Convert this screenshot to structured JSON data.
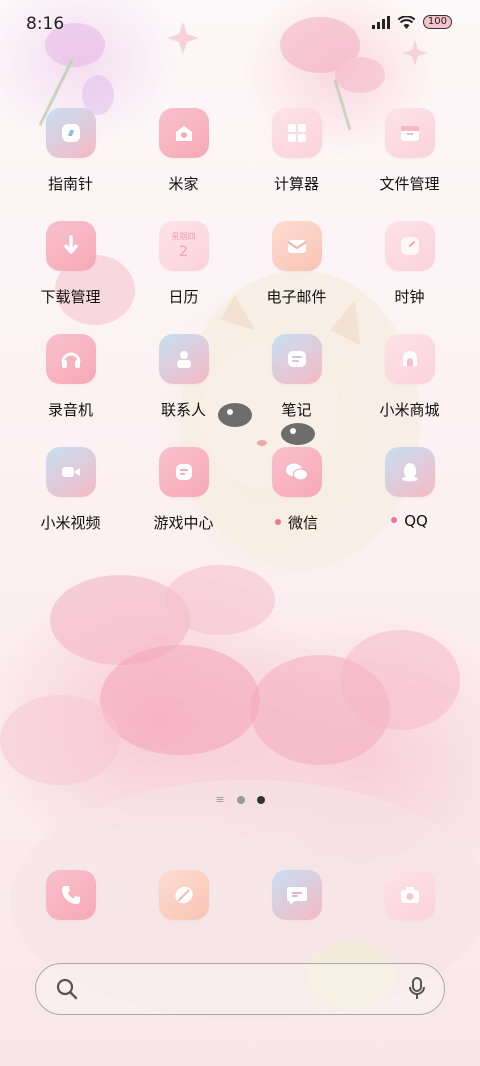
{
  "status_bar": {
    "time": "8:16",
    "battery": "100"
  },
  "apps": [
    {
      "label": "指南针",
      "icon": "compass-icon",
      "style": "blue",
      "badge": false
    },
    {
      "label": "米家",
      "icon": "mijia-icon",
      "style": "pink",
      "badge": false
    },
    {
      "label": "计算器",
      "icon": "calculator-icon",
      "style": "lightpink",
      "badge": false
    },
    {
      "label": "文件管理",
      "icon": "folder-icon",
      "style": "lightpink",
      "badge": false
    },
    {
      "label": "下载管理",
      "icon": "download-icon",
      "style": "pink",
      "badge": false
    },
    {
      "label": "日历",
      "icon": "calendar-icon",
      "style": "lightpink",
      "badge": false,
      "icon_text": {
        "day": "星期四",
        "date": "2"
      }
    },
    {
      "label": "电子邮件",
      "icon": "mail-icon",
      "style": "peach",
      "badge": false
    },
    {
      "label": "时钟",
      "icon": "clock-icon",
      "style": "lightpink",
      "badge": false
    },
    {
      "label": "录音机",
      "icon": "recorder-icon",
      "style": "pink",
      "badge": false
    },
    {
      "label": "联系人",
      "icon": "contacts-icon",
      "style": "blue",
      "badge": false
    },
    {
      "label": "笔记",
      "icon": "notes-icon",
      "style": "blue",
      "badge": false
    },
    {
      "label": "小米商城",
      "icon": "mi-store-icon",
      "style": "lightpink",
      "badge": false
    },
    {
      "label": "小米视频",
      "icon": "video-icon",
      "style": "blue",
      "badge": false
    },
    {
      "label": "游戏中心",
      "icon": "game-center-icon",
      "style": "pink",
      "badge": false
    },
    {
      "label": "微信",
      "icon": "wechat-icon",
      "style": "pink",
      "badge": true
    },
    {
      "label": "QQ",
      "icon": "qq-icon",
      "style": "blue",
      "badge": true
    }
  ],
  "pager": {
    "pages": 2,
    "current": 2
  },
  "dock": [
    {
      "icon": "phone-icon",
      "style": "pink"
    },
    {
      "icon": "browser-icon",
      "style": "peach"
    },
    {
      "icon": "messages-icon",
      "style": "blue"
    },
    {
      "icon": "camera-icon",
      "style": "lightpink"
    }
  ],
  "colors": {
    "accent_pink": "#f6a9b6",
    "badge_dot": "#e8798f"
  }
}
